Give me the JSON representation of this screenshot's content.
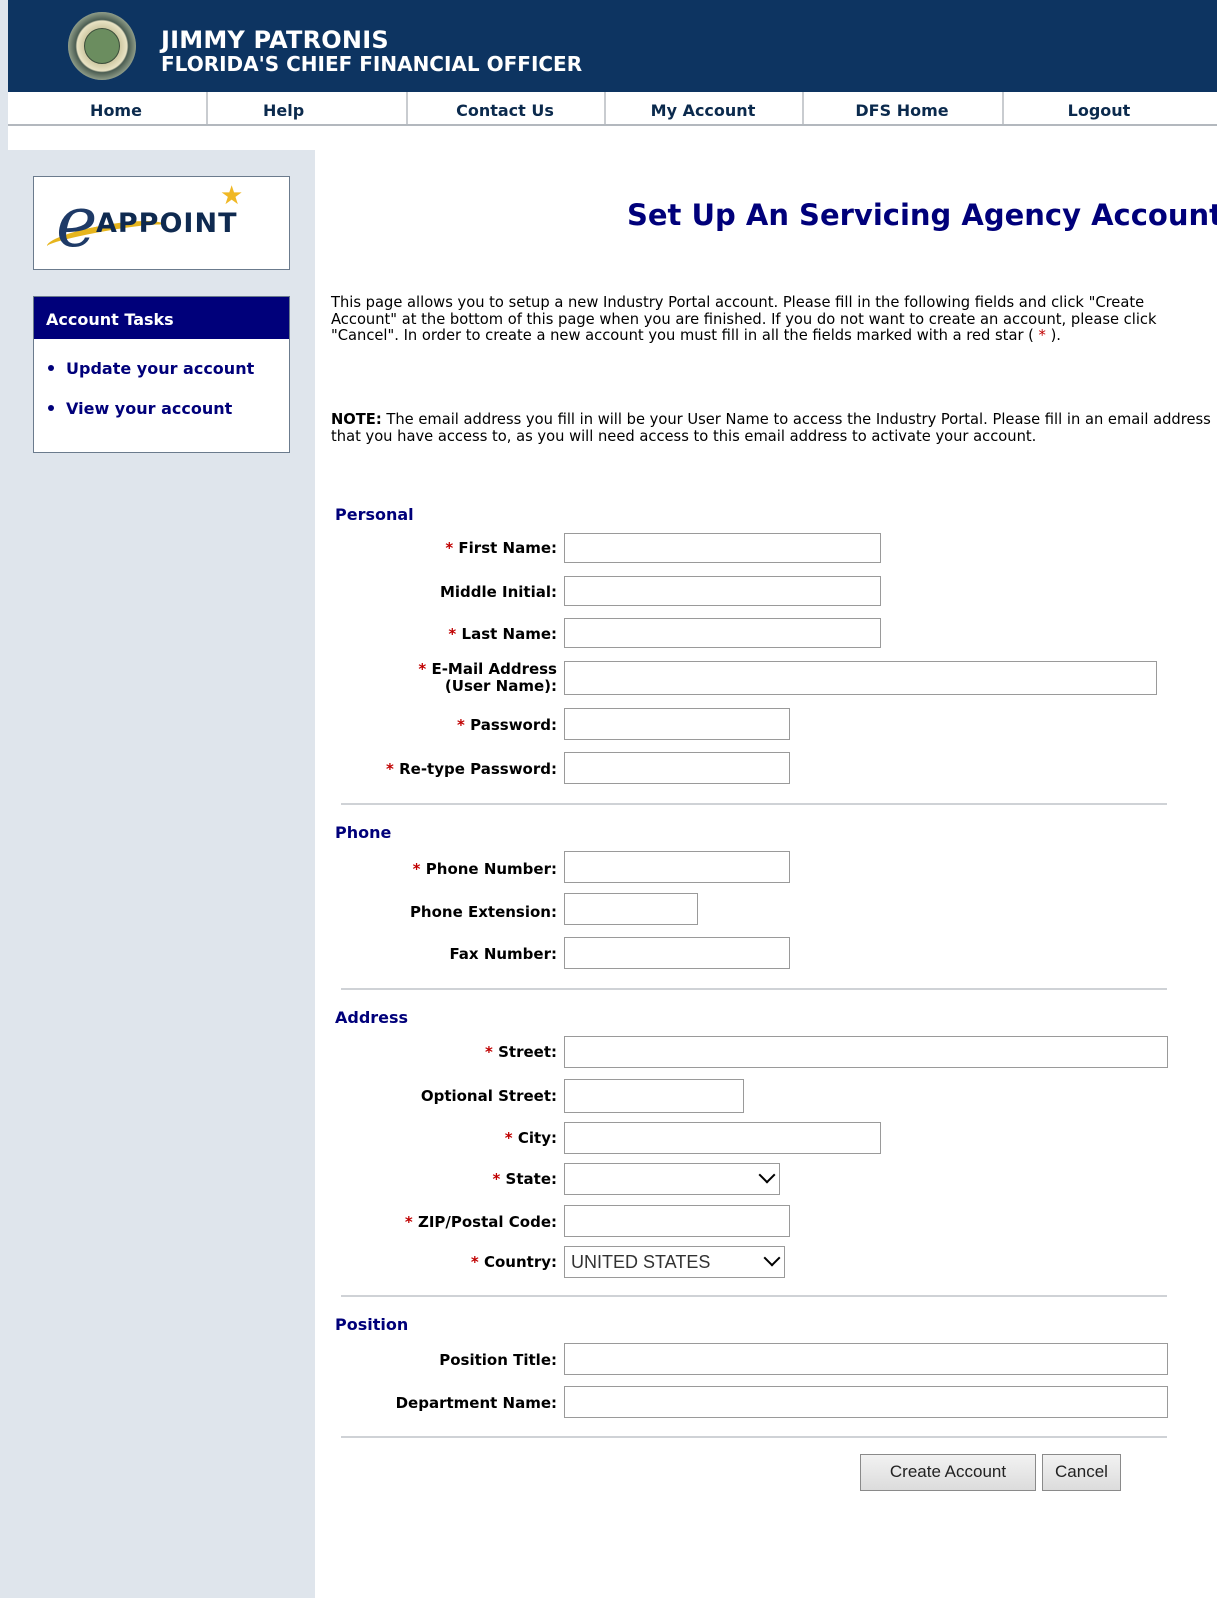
{
  "header": {
    "name": "JIMMY PATRONIS",
    "title": "FLORIDA'S CHIEF FINANCIAL OFFICER"
  },
  "nav": {
    "items": [
      "Home",
      "Help",
      "Contact Us",
      "My Account",
      "DFS Home",
      "Logout"
    ]
  },
  "sidebar": {
    "logo_text": "APPOINT",
    "logo_letter": "e",
    "tasks_title": "Account Tasks",
    "tasks": [
      "Update your account",
      "View your account"
    ]
  },
  "main": {
    "title": "Set Up An Servicing Agency Account",
    "intro_before": "This page allows you to setup a new Industry Portal account. Please fill in the following fields and click \"Create Account\" at the bottom of this page when you are finished. If you do not want to create an account, please click \"Cancel\". In order to create a new account you must fill in all the fields marked with a red star (",
    "intro_star": " * ",
    "intro_after": ").",
    "note_label": "NOTE:",
    "note_text": " The email address you fill in will be your User Name to access the Industry Portal. Please fill in an email address that you have access to, as you will need access to this email address to activate your account.",
    "required_mark": "*",
    "sections": {
      "personal": "Personal",
      "phone": "Phone",
      "address": "Address",
      "position": "Position"
    },
    "labels": {
      "first_name": "First Name:",
      "middle_initial": "Middle Initial:",
      "last_name": "Last Name:",
      "email_line1": "E-Mail Address",
      "email_line2": "(User Name):",
      "password": "Password:",
      "retype_password": "Re-type Password:",
      "phone_number": "Phone Number:",
      "phone_extension": "Phone Extension:",
      "fax_number": "Fax Number:",
      "street": "Street:",
      "optional_street": "Optional Street:",
      "city": "City:",
      "state": "State:",
      "zip": "ZIP/Postal Code:",
      "country": "Country:",
      "position_title": "Position Title:",
      "department_name": "Department Name:"
    },
    "values": {
      "state": "",
      "country": "UNITED STATES"
    },
    "buttons": {
      "create": "Create Account",
      "cancel": "Cancel"
    }
  }
}
